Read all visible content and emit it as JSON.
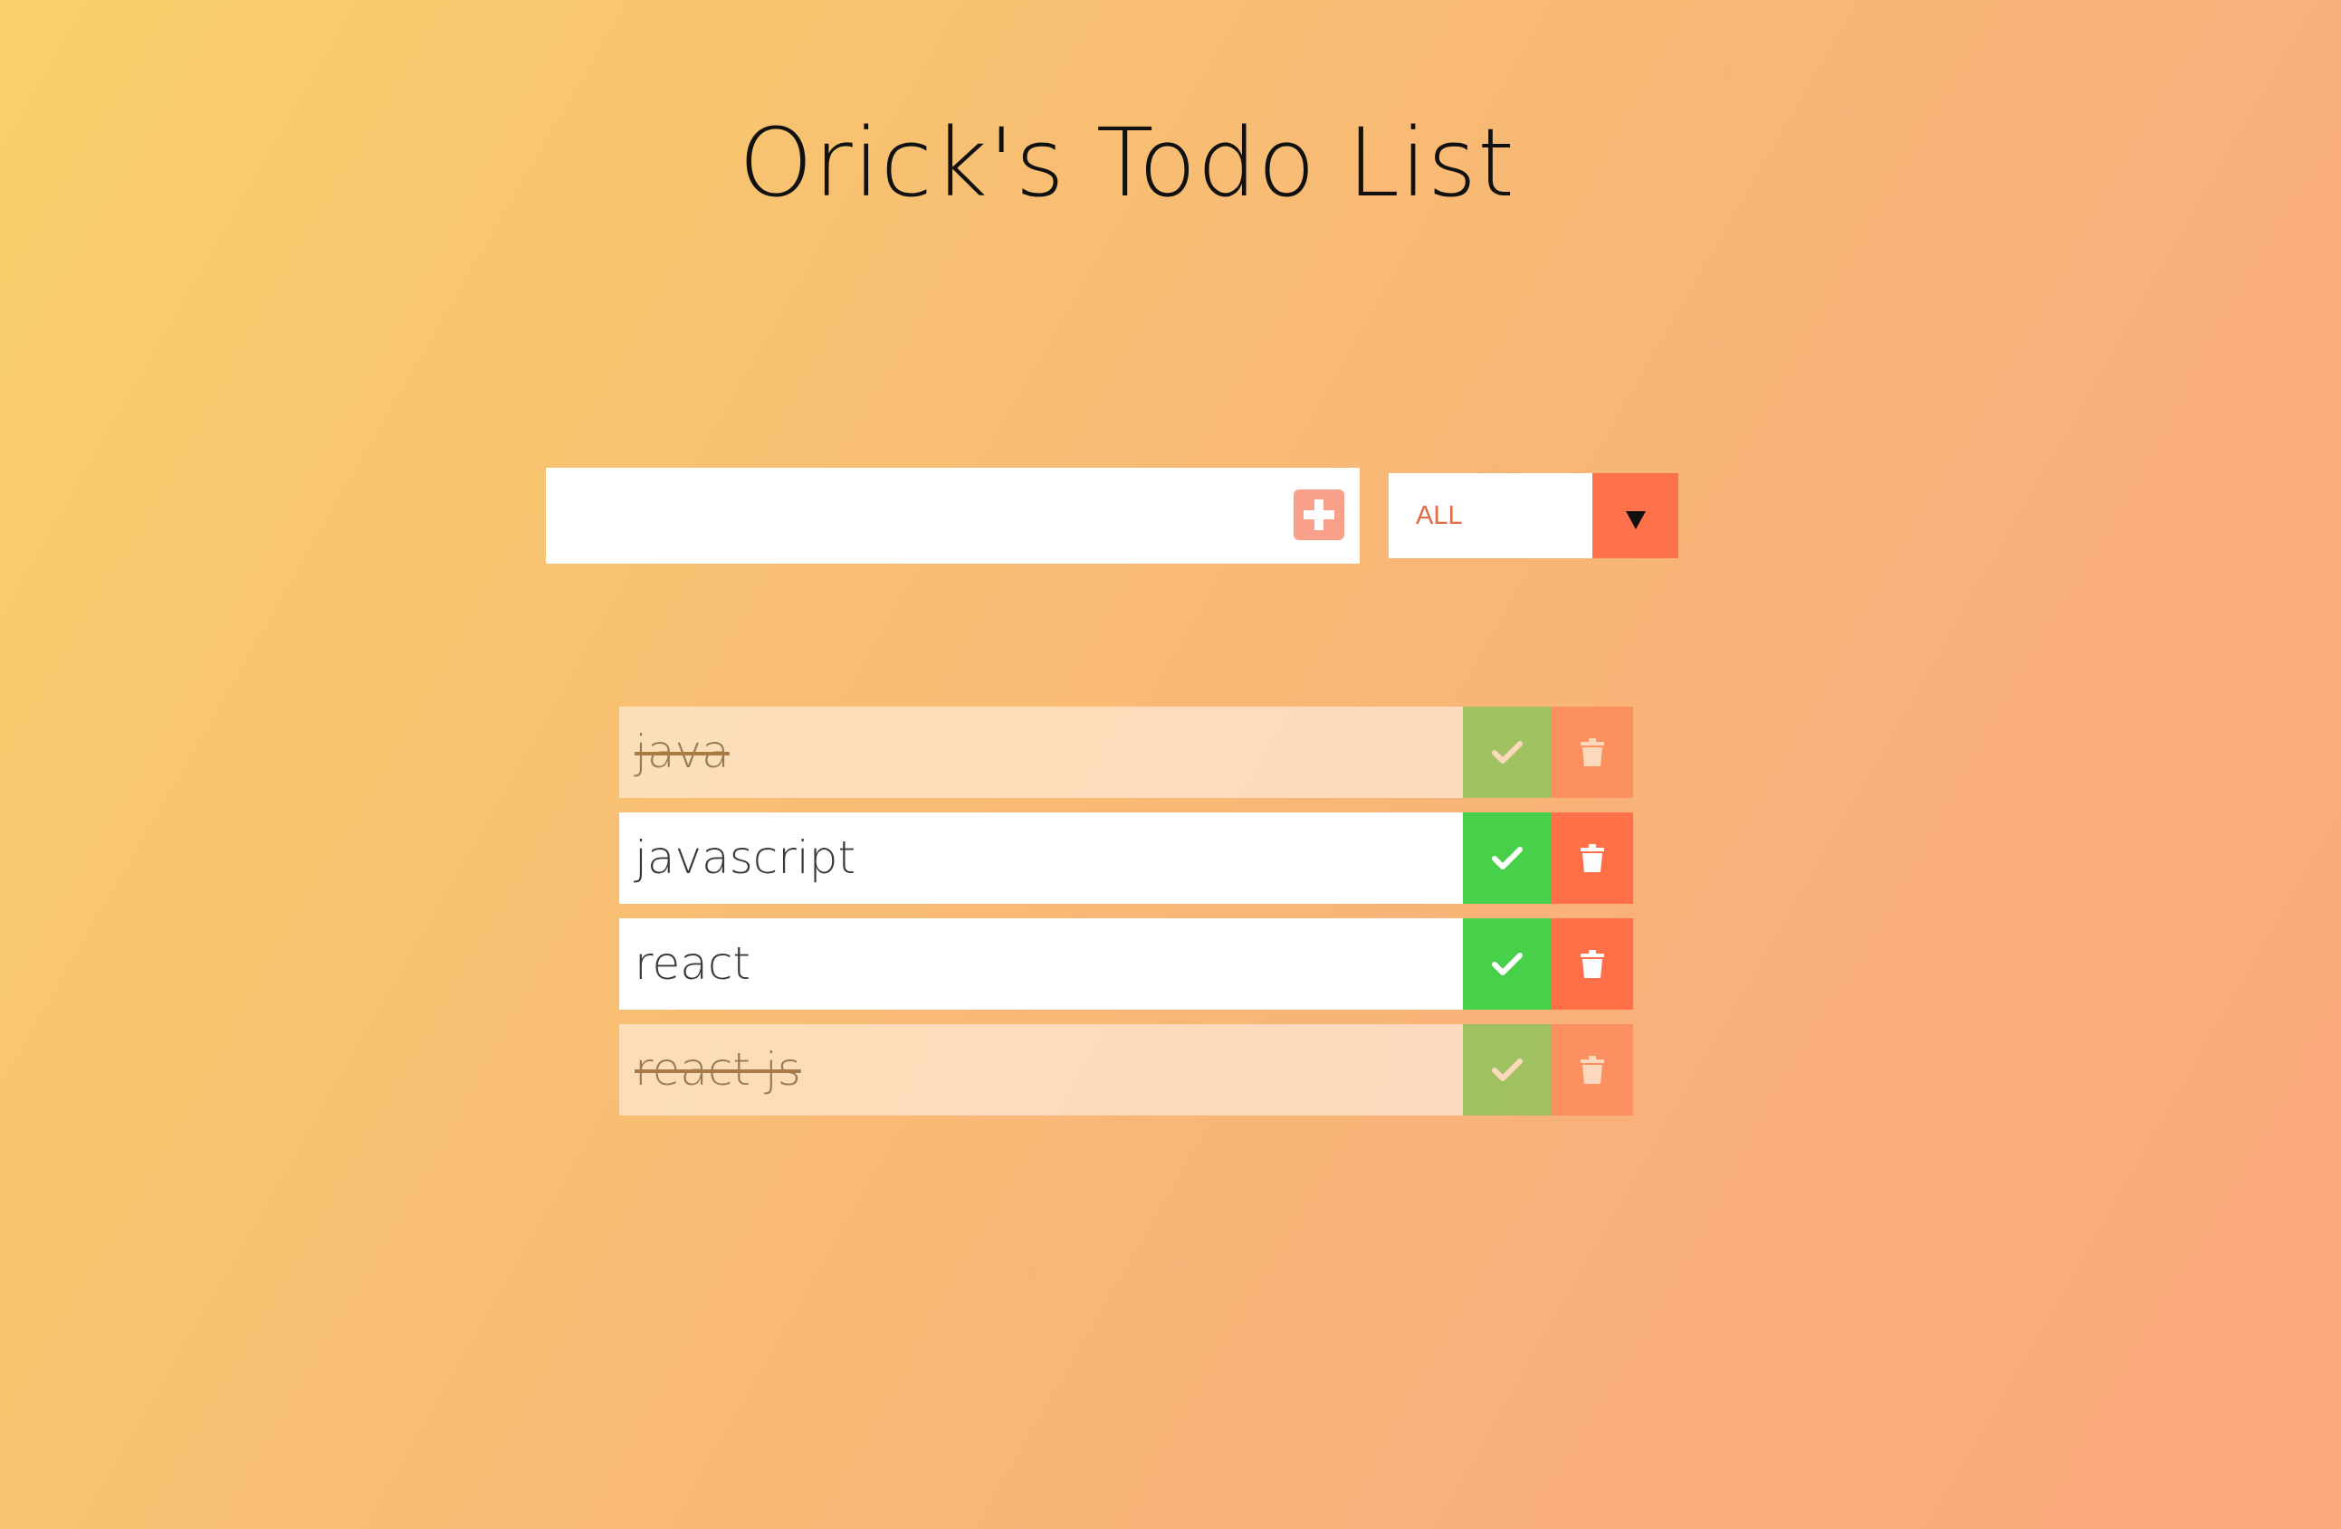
{
  "header": {
    "title": "Orick's Todo List"
  },
  "form": {
    "input_value": "",
    "add_icon": "plus-square-icon",
    "filter": {
      "selected": "ALL",
      "arrow_icon": "caret-down-icon"
    }
  },
  "todos": [
    {
      "text": "java",
      "completed": true
    },
    {
      "text": "javascript",
      "completed": false
    },
    {
      "text": "react",
      "completed": false
    },
    {
      "text": "react js",
      "completed": true
    }
  ],
  "colors": {
    "background_start": "#f8d06c",
    "background_end": "#fba87c",
    "accent": "#fe724b",
    "complete_button": "#49d04b",
    "trash_button": "#ff7048",
    "add_button": "#f9a08a"
  }
}
